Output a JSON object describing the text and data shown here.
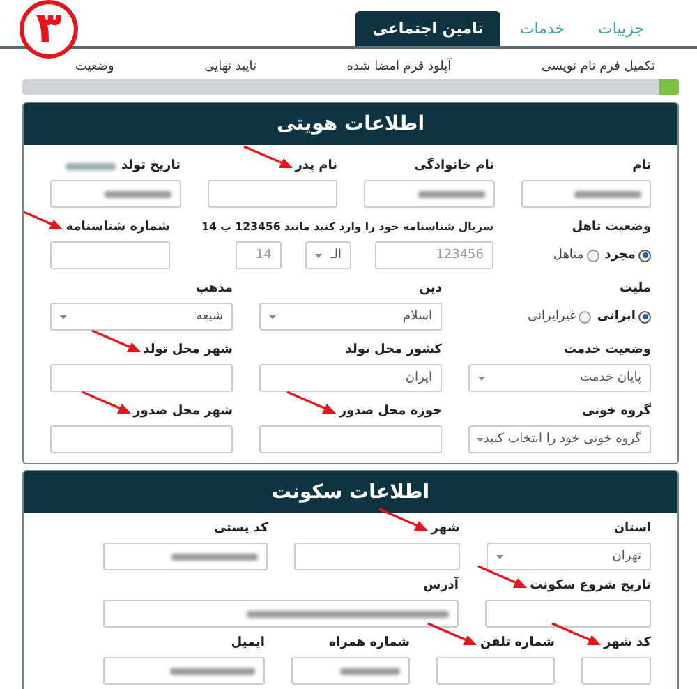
{
  "badge": "۳",
  "tabs": [
    {
      "label": "جزییات",
      "selected": false
    },
    {
      "label": "خدمات",
      "selected": false
    },
    {
      "label": "تامین اجتماعی",
      "selected": true
    }
  ],
  "progress": {
    "steps": [
      "تکمیل فرم نام نویسی",
      "آپلود فرم امضا شده",
      "تایید نهایی",
      "وضعیت"
    ],
    "level": 0.03
  },
  "sections": [
    {
      "title": "اطلاعات هویتی",
      "rows": [
        {
          "fields": [
            {
              "kind": "input",
              "label": "نام",
              "blurred": true,
              "arrow": false
            },
            {
              "kind": "input",
              "label": "نام خانوادگی",
              "blurred": true,
              "arrow": false
            },
            {
              "kind": "input",
              "label": "نام پدر",
              "blurred": false,
              "arrow": true
            },
            {
              "kind": "input",
              "label": "تاریخ تولد",
              "label_blurred": true,
              "blurred": true,
              "arrow": false
            }
          ]
        },
        {
          "fields": [
            {
              "kind": "radios",
              "label": "وضعیت تاهل",
              "arrow": false,
              "options": [
                {
                  "label": "مجرد",
                  "selected": true
                },
                {
                  "label": "متاهل",
                  "selected": false
                }
              ]
            },
            {
              "kind": "serial",
              "label": "سریال شناسنامه خود را وارد کنید مانند 123456 ب 14",
              "arrow": false,
              "parts": [
                {
                  "kind": "input",
                  "placeholder": "123456"
                },
                {
                  "kind": "select",
                  "value": "الـ"
                },
                {
                  "kind": "input",
                  "placeholder": "14"
                }
              ]
            },
            {
              "kind": "input",
              "label": "شماره شناسنامه",
              "blurred": false,
              "arrow": true
            }
          ]
        },
        {
          "fields": [
            {
              "kind": "radios",
              "label": "ملیت",
              "arrow": false,
              "options": [
                {
                  "label": "ایرانی",
                  "selected": true
                },
                {
                  "label": "غیرایرانی",
                  "selected": false
                }
              ]
            },
            {
              "kind": "select",
              "label": "دین",
              "value": "اسلام",
              "arrow": false
            },
            {
              "kind": "select",
              "label": "مذهب",
              "value": "شیعه",
              "arrow": false
            }
          ]
        },
        {
          "fields": [
            {
              "kind": "select",
              "label": "وضعیت خدمت",
              "value": "پایان خدمت",
              "arrow": false
            },
            {
              "kind": "input",
              "label": "کشور محل تولد",
              "value": "ایران",
              "blurred": false,
              "arrow": false
            },
            {
              "kind": "input",
              "label": "شهر محل تولد",
              "blurred": false,
              "arrow": true
            }
          ]
        },
        {
          "fields": [
            {
              "kind": "select",
              "label": "گروه خونی",
              "value": "گروه خونی خود را انتخاب کنید",
              "arrow": false
            },
            {
              "kind": "input",
              "label": "حوزه محل صدور",
              "blurred": false,
              "arrow": true
            },
            {
              "kind": "input",
              "label": "شهر محل صدور",
              "blurred": false,
              "arrow": true
            }
          ]
        }
      ]
    },
    {
      "title": "اطلاعات سکونت",
      "rows": [
        {
          "fields": [
            {
              "kind": "select",
              "label": "استان",
              "value": "تهران",
              "arrow": false
            },
            {
              "kind": "input",
              "label": "شهر",
              "blurred": false,
              "arrow": true
            },
            {
              "kind": "input",
              "label": "کد پستی",
              "blurred": true,
              "arrow": false
            }
          ]
        },
        {
          "fields": [
            {
              "kind": "input",
              "label": "تاریخ شروع سکونت",
              "blurred": false,
              "arrow": true
            },
            {
              "kind": "input",
              "label": "آدرس",
              "blurred": true,
              "arrow": false
            }
          ]
        },
        {
          "fields": [
            {
              "kind": "input",
              "label": "کد شهر",
              "blurred": false,
              "arrow": true
            },
            {
              "kind": "input",
              "label": "شماره تلفن",
              "blurred": false,
              "arrow": true
            },
            {
              "kind": "input",
              "label": "شماره همراه",
              "blurred": true,
              "arrow": false
            },
            {
              "kind": "input",
              "label": "ایمیل",
              "blurred": true,
              "arrow": false
            }
          ]
        }
      ]
    }
  ]
}
